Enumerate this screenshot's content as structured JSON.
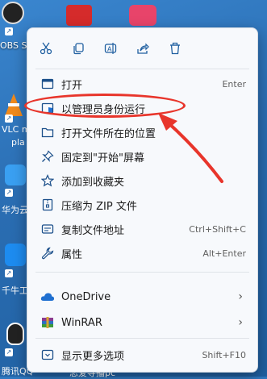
{
  "desktop": {
    "icons": [
      {
        "label": "OBS S"
      },
      {
        "label": "VLC m"
      },
      {
        "label": "pla"
      },
      {
        "label": "华为云"
      },
      {
        "label": "千牛工"
      },
      {
        "label": "腾讯QQ"
      },
      {
        "label": "恋爱导播pc"
      }
    ]
  },
  "toolbar": {
    "buttons": [
      {
        "name": "cut",
        "icon": "scissors-icon"
      },
      {
        "name": "copy",
        "icon": "copy-icon"
      },
      {
        "name": "rename",
        "icon": "rename-icon"
      },
      {
        "name": "share",
        "icon": "share-icon"
      },
      {
        "name": "delete",
        "icon": "trash-icon"
      }
    ]
  },
  "menu": {
    "open": {
      "label": "打开",
      "shortcut": "Enter"
    },
    "run_as_admin": {
      "label": "以管理员身份运行"
    },
    "open_location": {
      "label": "打开文件所在的位置"
    },
    "pin_start": {
      "label": "固定到\"开始\"屏幕"
    },
    "add_favorites": {
      "label": "添加到收藏夹"
    },
    "compress_zip": {
      "label": "压缩为 ZIP 文件"
    },
    "copy_path": {
      "label": "复制文件地址",
      "shortcut": "Ctrl+Shift+C"
    },
    "properties": {
      "label": "属性",
      "shortcut": "Alt+Enter"
    },
    "onedrive": {
      "label": "OneDrive"
    },
    "winrar": {
      "label": "WinRAR"
    },
    "more_options": {
      "label": "显示更多选项",
      "shortcut": "Shift+F10"
    }
  },
  "colors": {
    "annotation": "#e8352b",
    "accent": "#1f5fa0"
  }
}
